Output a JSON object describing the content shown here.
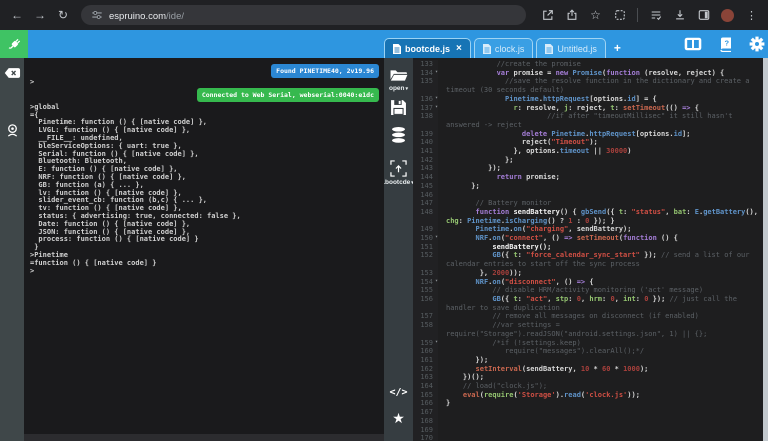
{
  "browser": {
    "back": "←",
    "forward": "→",
    "reload": "↻",
    "url_host": "espruino.com",
    "url_path": "/ide/",
    "bookmark_star": "☆",
    "menu_dots": "⋮"
  },
  "header": {
    "tabs": [
      {
        "label": "bootcde.js",
        "state": "active"
      },
      {
        "label": "clock.js",
        "state": "inactive"
      },
      {
        "label": "Untitled.js",
        "state": "inactive"
      }
    ],
    "close_label": "×",
    "new_tab_label": "+"
  },
  "console": {
    "badges": [
      {
        "text": "Found PINETIME40, 2v19.96",
        "color": "#2b87d3"
      },
      {
        "text": "Connected to Web Serial, webserial:0040:e1dc",
        "color": "#36b94e"
      }
    ],
    "prompt": ">",
    "lines": [
      ">global",
      "={",
      "  Pinetime: function () { [native code] },",
      "  LVGL: function () { [native code] },",
      "  __FILE__: undefined,",
      "  bleServiceOptions: { uart: true },",
      "  Serial: function () { [native code] },",
      "  Bluetooth: Bluetooth,",
      "  E: function () { [native code] },",
      "  NRF: function () { [native code] },",
      "  GB: function (a) { ... },",
      "  lv: function () { [native code] },",
      "  slider_event_cb: function (b,c) { ... },",
      "  tv: function () { [native code] },",
      "  status: { advertising: true, connected: false },",
      "  Date: function () { [native code] },",
      "  JSON: function () { [native code] },",
      "  process: function () { [native code] }",
      " }",
      ">Pinetime",
      "=function () { [native code] }",
      ">"
    ]
  },
  "toolbar": {
    "open_label": "open",
    "flash_label": ".bootcde",
    "caret": "▾",
    "code_label": "</>",
    "star": "★"
  },
  "editor": {
    "lines": [
      {
        "n": "133",
        "t": [
          [
            "c",
            "            //create the promise"
          ]
        ]
      },
      {
        "n": "134",
        "f": 1,
        "t": [
          [
            "w",
            "            "
          ],
          [
            "k",
            "var"
          ],
          [
            "w",
            " promise = "
          ],
          [
            "k",
            "new"
          ],
          [
            "w",
            " "
          ],
          [
            "b",
            "Promise"
          ],
          [
            "w",
            "("
          ],
          [
            "k",
            "function"
          ],
          [
            "w",
            " (resolve, reject) {"
          ]
        ]
      },
      {
        "n": "135",
        "t": [
          [
            "c",
            "              //save the resolve function in the dictionary and create a timeout (30 seconds default)"
          ]
        ]
      },
      {
        "n": "136",
        "f": 1,
        "t": [
          [
            "w",
            "              "
          ],
          [
            "b",
            "Pinetime"
          ],
          [
            "w",
            "."
          ],
          [
            "b",
            "httpRequest"
          ],
          [
            "w",
            "[options."
          ],
          [
            "b",
            "id"
          ],
          [
            "w",
            "] = {"
          ]
        ]
      },
      {
        "n": "137",
        "f": 1,
        "t": [
          [
            "w",
            "                "
          ],
          [
            "g",
            "r"
          ],
          [
            "w",
            ": resolve, "
          ],
          [
            "g",
            "j"
          ],
          [
            "w",
            ": reject, "
          ],
          [
            "g",
            "t"
          ],
          [
            "w",
            ": "
          ],
          [
            "f",
            "setTimeout"
          ],
          [
            "w",
            "(() "
          ],
          [
            "k",
            "=>"
          ],
          [
            "w",
            " {"
          ]
        ]
      },
      {
        "n": "138",
        "t": [
          [
            "c",
            "                        //if after \"timeoutMillisec\" it still hasn't answered -> reject"
          ]
        ]
      },
      {
        "n": "139",
        "t": [
          [
            "w",
            "                  "
          ],
          [
            "k",
            "delete"
          ],
          [
            "w",
            " "
          ],
          [
            "b",
            "Pinetime"
          ],
          [
            "w",
            "."
          ],
          [
            "b",
            "httpRequest"
          ],
          [
            "w",
            "[options."
          ],
          [
            "b",
            "id"
          ],
          [
            "w",
            "];"
          ]
        ]
      },
      {
        "n": "140",
        "t": [
          [
            "w",
            "                  reject("
          ],
          [
            "s",
            "\"Timeout\""
          ],
          [
            "w",
            ");"
          ]
        ]
      },
      {
        "n": "141",
        "t": [
          [
            "w",
            "                }, options."
          ],
          [
            "b",
            "timeout"
          ],
          [
            "w",
            " || "
          ],
          [
            "n",
            "30000"
          ],
          [
            "w",
            ")"
          ]
        ]
      },
      {
        "n": "142",
        "t": [
          [
            "w",
            "              };"
          ]
        ]
      },
      {
        "n": "143",
        "t": [
          [
            "w",
            "          });"
          ]
        ]
      },
      {
        "n": "144",
        "t": [
          [
            "w",
            "            "
          ],
          [
            "k",
            "return"
          ],
          [
            "w",
            " promise;"
          ]
        ]
      },
      {
        "n": "145",
        "t": [
          [
            "w",
            "      };"
          ]
        ]
      },
      {
        "n": "146",
        "t": []
      },
      {
        "n": "147",
        "t": [
          [
            "c",
            "       // Battery monitor"
          ]
        ]
      },
      {
        "n": "148",
        "t": [
          [
            "w",
            "       "
          ],
          [
            "k",
            "function"
          ],
          [
            "w",
            " "
          ],
          [
            "wb",
            "sendBattery"
          ],
          [
            "w",
            "() { "
          ],
          [
            "b",
            "gbSend"
          ],
          [
            "w",
            "({ "
          ],
          [
            "g",
            "t"
          ],
          [
            "w",
            ": "
          ],
          [
            "s",
            "\"status\""
          ],
          [
            "w",
            ", "
          ],
          [
            "g",
            "bat"
          ],
          [
            "w",
            ": "
          ],
          [
            "b",
            "E"
          ],
          [
            "w",
            "."
          ],
          [
            "b",
            "getBattery"
          ],
          [
            "w",
            "(), "
          ],
          [
            "g",
            "chg"
          ],
          [
            "w",
            ": "
          ],
          [
            "b",
            "Pinetime"
          ],
          [
            "w",
            "."
          ],
          [
            "b",
            "isCharging"
          ],
          [
            "w",
            "() ? "
          ],
          [
            "n",
            "1"
          ],
          [
            "w",
            " : "
          ],
          [
            "n",
            "0"
          ],
          [
            "w",
            " }); }"
          ]
        ]
      },
      {
        "n": "149",
        "t": [
          [
            "w",
            "       "
          ],
          [
            "b",
            "Pinetime"
          ],
          [
            "w",
            "."
          ],
          [
            "b",
            "on"
          ],
          [
            "w",
            "("
          ],
          [
            "s",
            "\"charging\""
          ],
          [
            "w",
            ", sendBattery);"
          ]
        ]
      },
      {
        "n": "150",
        "f": 1,
        "t": [
          [
            "w",
            "       "
          ],
          [
            "b",
            "NRF"
          ],
          [
            "w",
            "."
          ],
          [
            "b",
            "on"
          ],
          [
            "w",
            "("
          ],
          [
            "s",
            "\"connect\""
          ],
          [
            "w",
            ", () "
          ],
          [
            "k",
            "=>"
          ],
          [
            "w",
            " "
          ],
          [
            "f",
            "setTimeout"
          ],
          [
            "w",
            "("
          ],
          [
            "k",
            "function"
          ],
          [
            "w",
            " () {"
          ]
        ]
      },
      {
        "n": "151",
        "t": [
          [
            "wb",
            "           sendBattery();"
          ]
        ]
      },
      {
        "n": "152",
        "t": [
          [
            "w",
            "           "
          ],
          [
            "b",
            "GB"
          ],
          [
            "w",
            "({ "
          ],
          [
            "g",
            "t"
          ],
          [
            "w",
            ": "
          ],
          [
            "s",
            "\"force_calendar_sync_start\""
          ],
          [
            "w",
            " }); "
          ],
          [
            "c",
            "// send a list of our calendar entries to start off the sync process"
          ]
        ]
      },
      {
        "n": "153",
        "t": [
          [
            "w",
            "        }, "
          ],
          [
            "n",
            "2000"
          ],
          [
            "w",
            "));"
          ]
        ]
      },
      {
        "n": "154",
        "f": 1,
        "t": [
          [
            "w",
            "       "
          ],
          [
            "b",
            "NRF"
          ],
          [
            "w",
            "."
          ],
          [
            "b",
            "on"
          ],
          [
            "w",
            "("
          ],
          [
            "s",
            "\"disconnect\""
          ],
          [
            "w",
            ", () "
          ],
          [
            "k",
            "=>"
          ],
          [
            "w",
            " {"
          ]
        ]
      },
      {
        "n": "155",
        "t": [
          [
            "c",
            "           // disable HRM/activity monitoring ('act' message)"
          ]
        ]
      },
      {
        "n": "156",
        "t": [
          [
            "w",
            "           "
          ],
          [
            "b",
            "GB"
          ],
          [
            "w",
            "({ "
          ],
          [
            "g",
            "t"
          ],
          [
            "w",
            ": "
          ],
          [
            "s",
            "\"act\""
          ],
          [
            "w",
            ", "
          ],
          [
            "g",
            "stp"
          ],
          [
            "w",
            ": "
          ],
          [
            "n",
            "0"
          ],
          [
            "w",
            ", "
          ],
          [
            "g",
            "hrm"
          ],
          [
            "w",
            ": "
          ],
          [
            "n",
            "0"
          ],
          [
            "w",
            ", "
          ],
          [
            "g",
            "int"
          ],
          [
            "w",
            ": "
          ],
          [
            "n",
            "0"
          ],
          [
            "w",
            " }); "
          ],
          [
            "c",
            "// just call the handler to save duplication"
          ]
        ]
      },
      {
        "n": "157",
        "t": [
          [
            "c",
            "           // remove all messages on disconnect (if enabled)"
          ]
        ]
      },
      {
        "n": "158",
        "t": [
          [
            "c",
            "           //var settings = require(\"Storage\").readJSON(\"android.settings.json\", 1) || {};"
          ]
        ]
      },
      {
        "n": "159",
        "f": 1,
        "t": [
          [
            "c",
            "           /*if (!settings.keep)"
          ]
        ]
      },
      {
        "n": "160",
        "t": [
          [
            "c",
            "              require(\"messages\").clearAll();*/"
          ]
        ]
      },
      {
        "n": "161",
        "t": [
          [
            "w",
            "       });"
          ]
        ]
      },
      {
        "n": "162",
        "t": [
          [
            "w",
            "       "
          ],
          [
            "f",
            "setInterval"
          ],
          [
            "w",
            "(sendBattery, "
          ],
          [
            "n",
            "10"
          ],
          [
            "w",
            " * "
          ],
          [
            "n",
            "60"
          ],
          [
            "w",
            " * "
          ],
          [
            "n",
            "1000"
          ],
          [
            "w",
            ");"
          ]
        ]
      },
      {
        "n": "163",
        "t": [
          [
            "w",
            "    })();"
          ]
        ]
      },
      {
        "n": "164",
        "t": [
          [
            "c",
            "    // load(\"clock.js\");"
          ]
        ]
      },
      {
        "n": "165",
        "t": [
          [
            "w",
            "    "
          ],
          [
            "f",
            "eval"
          ],
          [
            "w",
            "("
          ],
          [
            "g",
            "require"
          ],
          [
            "w",
            "("
          ],
          [
            "s",
            "'Storage'"
          ],
          [
            "w",
            ")."
          ],
          [
            "b",
            "read"
          ],
          [
            "w",
            "("
          ],
          [
            "s",
            "'clock.js'"
          ],
          [
            "w",
            "));"
          ]
        ]
      },
      {
        "n": "166",
        "t": [
          [
            "w",
            "}"
          ]
        ]
      },
      {
        "n": "167",
        "t": []
      },
      {
        "n": "168",
        "t": []
      },
      {
        "n": "169",
        "t": []
      },
      {
        "n": "170",
        "t": []
      }
    ]
  },
  "colors": {
    "header_blue": "#2e96e0",
    "active_tab_blue": "#1774b5",
    "connect_green": "#3fc364",
    "badge_blue": "#2b87d3",
    "badge_green": "#36b94e",
    "editor_bg": "#1e1e1f",
    "toolbar_bg": "#363d41"
  }
}
